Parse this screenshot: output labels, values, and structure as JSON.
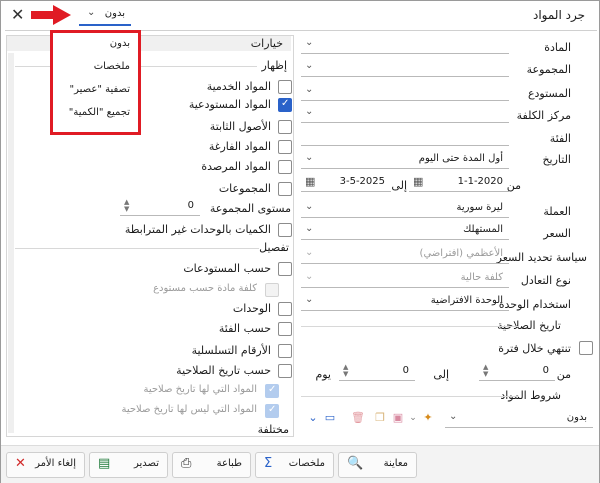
{
  "window": {
    "title": "جرد المواد",
    "close_glyph": "✕"
  },
  "top_dropdown": {
    "value": "بدون"
  },
  "popup_menu": {
    "items": [
      "بدون",
      "ملخصات",
      "تصفية \"عصير\"",
      "تجميع \"الكمية\""
    ]
  },
  "options_panel": {
    "header": "خيارات",
    "show_section": {
      "label": "إظهار",
      "items": [
        {
          "label": "المواد الخدمية",
          "checked": false
        },
        {
          "label": "المواد المستودعية",
          "checked": true
        },
        {
          "label": "الأصول الثابتة",
          "checked": false
        },
        {
          "label": "المواد الفارغة",
          "checked": false
        },
        {
          "label": "المواد المرصدة",
          "checked": false
        },
        {
          "label": "المجموعات",
          "checked": false
        }
      ],
      "group_level_label": "مستوى المجموعة",
      "group_level_value": "0",
      "unrelated_units_label": "الكميات بالوحدات غير المترابطة"
    },
    "detail_section": {
      "label": "تفصيل",
      "items": [
        {
          "label": "حسب المستودعات",
          "state": "off"
        },
        {
          "label": "كلفة مادة حسب مستودع",
          "state": "disabled-empty"
        },
        {
          "label": "الوحدات",
          "state": "off"
        },
        {
          "label": "حسب الفئة",
          "state": "off"
        },
        {
          "label": "الأرقام التسلسلية",
          "state": "off"
        },
        {
          "label": "حسب تاريخ الصلاحية",
          "state": "off"
        },
        {
          "label": "المواد التي لها تاريخ صلاحية",
          "state": "disabled-checked"
        },
        {
          "label": "المواد التي ليس لها تاريخ صلاحية",
          "state": "disabled-checked"
        }
      ]
    },
    "misc_section": {
      "label": "مختلفة"
    }
  },
  "form": {
    "material_label": "المادة",
    "group_label": "المجموعة",
    "warehouse_label": "المستودع",
    "cost_center_label": "مركز الكلفة",
    "category_label": "الفئة",
    "date_label": "التاريخ",
    "date_value": "أول المدة حتى اليوم",
    "from_label": "من",
    "from_date": "1-1-2020",
    "to_label": "إلى",
    "to_date": "3-5-2025",
    "currency_label": "العملة",
    "currency_value": "ليرة سورية",
    "price_label": "السعر",
    "price_value": "المستهلك",
    "price_policy_label": "سياسة تحديد السعر",
    "price_policy_value": "الأعظمي (افتراضي)",
    "equalization_label": "نوع التعادل",
    "equalization_value": "كلفة حالية",
    "unit_usage_label": "استخدام الوحدة",
    "unit_usage_value": "الوحدة الافتراضية",
    "expiry_section_label": "تاريخ الصلاحية",
    "expiring_within_label": "تنتهي خلال فترة",
    "expiry_from_label": "من",
    "expiry_from_value": "0",
    "expiry_to_label": "إلى",
    "expiry_to_value": "0",
    "day_label": "يوم",
    "conditions_label": "شروط المواد",
    "conditions_value": "بدون"
  },
  "buttons": {
    "cancel": "إلغاء الأمر",
    "export": "تصدير",
    "print": "طباعة",
    "summaries": "ملخصات",
    "preview": "معاينة"
  },
  "colors": {
    "accent": "#2a62c9",
    "highlight_red": "#e01b24"
  }
}
